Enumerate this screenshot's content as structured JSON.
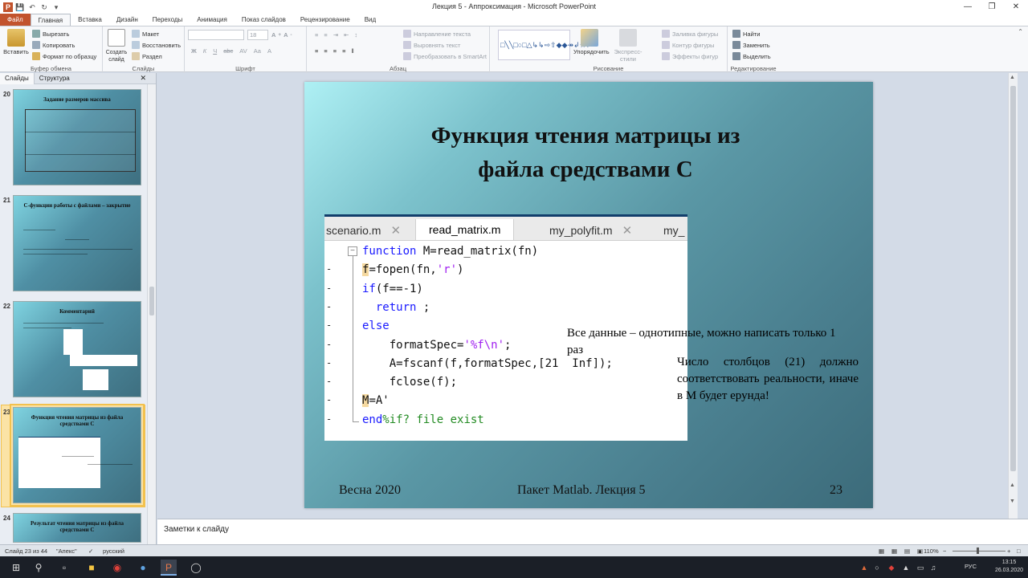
{
  "window": {
    "title": "Лекция 5 - Аппроксимация - Microsoft PowerPoint"
  },
  "ribbon_tabs": [
    "Файл",
    "Главная",
    "Вставка",
    "Дизайн",
    "Переходы",
    "Анимация",
    "Показ слайдов",
    "Рецензирование",
    "Вид"
  ],
  "ribbon": {
    "clipboard": {
      "paste": "Вставить",
      "cut": "Вырезать",
      "copy": "Копировать",
      "format_painter": "Формат по образцу",
      "group_name": "Буфер обмена"
    },
    "slides": {
      "new_slide": "Создать слайд",
      "layout": "Макет",
      "reset": "Восстановить",
      "section": "Раздел",
      "group_name": "Слайды"
    },
    "font": {
      "size": "18",
      "group_name": "Шрифт"
    },
    "paragraph": {
      "text_direction": "Направление текста",
      "align_text": "Выровнять текст",
      "smartart": "Преобразовать в SmartArt",
      "group_name": "Абзац"
    },
    "drawing": {
      "arrange": "Упорядочить",
      "quick_styles": "Экспресс-стили",
      "fill": "Заливка фигуры",
      "outline": "Контур фигуры",
      "effects": "Эффекты фигур",
      "group_name": "Рисование"
    },
    "editing": {
      "find": "Найти",
      "replace": "Заменить",
      "select": "Выделить",
      "group_name": "Редактирование"
    }
  },
  "left_pane": {
    "tabs": [
      "Слайды",
      "Структура"
    ],
    "thumbnails": [
      {
        "num": "20",
        "title": "Задание размеров массива"
      },
      {
        "num": "21",
        "title": "С-функции работы с файлами – закрытие"
      },
      {
        "num": "22",
        "title": "Комментарий"
      },
      {
        "num": "23",
        "title": "Функция чтения матрицы из файла средствами С"
      },
      {
        "num": "24",
        "title": "Результат чтения матрицы из файла средствами С"
      }
    ]
  },
  "slide": {
    "title_line1": "Функция чтения матрицы из",
    "title_line2": "файла средствами С",
    "editor_tabs": [
      "scenario.m",
      "read_matrix.m",
      "my_polyfit.m",
      "my_"
    ],
    "code_lines": [
      [
        {
          "t": "function ",
          "c": "kw"
        },
        {
          "t": "M=read_matrix(fn)",
          "c": "blk"
        }
      ],
      [
        {
          "t": "f",
          "c": "blkhl"
        },
        {
          "t": "=fopen(fn,",
          "c": "blk"
        },
        {
          "t": "'r'",
          "c": "str"
        },
        {
          "t": ")",
          "c": "blk"
        }
      ],
      [
        {
          "t": "if",
          "c": "kw"
        },
        {
          "t": "(f==-1)",
          "c": "blk"
        }
      ],
      [
        {
          "t": "  return",
          "c": "kw"
        },
        {
          "t": " ;",
          "c": "blk"
        }
      ],
      [
        {
          "t": "else",
          "c": "kw"
        }
      ],
      [
        {
          "t": "    formatSpec=",
          "c": "blk"
        },
        {
          "t": "'%f\\n'",
          "c": "str"
        },
        {
          "t": ";",
          "c": "blk"
        }
      ],
      [
        {
          "t": "    A=fscanf(f,formatSpec,[21  Inf]);",
          "c": "blk"
        }
      ],
      [
        {
          "t": "    fclose(f);",
          "c": "blk"
        }
      ],
      [
        {
          "t": "M",
          "c": "blkhl"
        },
        {
          "t": "=A'",
          "c": "blk"
        }
      ],
      [
        {
          "t": "end",
          "c": "kw"
        },
        {
          "t": "%if? file exist",
          "c": "cm"
        }
      ]
    ],
    "note1": "Все данные – однотипные, можно написать только 1 раз",
    "note2": "Число столбцов (21) должно соответствовать реальности, иначе в М будет ерунда!",
    "footer_left": "Весна 2020",
    "footer_center": "Пакет Matlab. Лекция 5",
    "footer_right": "23"
  },
  "notes": {
    "placeholder": "Заметки к слайду"
  },
  "status": {
    "slide_counter": "Слайд 23 из 44",
    "theme": "\"Апекс\"",
    "language": "русский",
    "zoom": "110%"
  },
  "taskbar": {
    "lang": "РУС",
    "time": "13:15",
    "date": "26.03.2020"
  },
  "colors": {
    "accent_file_tab": "#c2532d",
    "slide_gradient_light": "#aef0f4",
    "slide_gradient_dark": "#3c6b7a",
    "matlab_keyword": "#1a1aff",
    "matlab_string": "#a020f0",
    "matlab_comment": "#228b22"
  }
}
